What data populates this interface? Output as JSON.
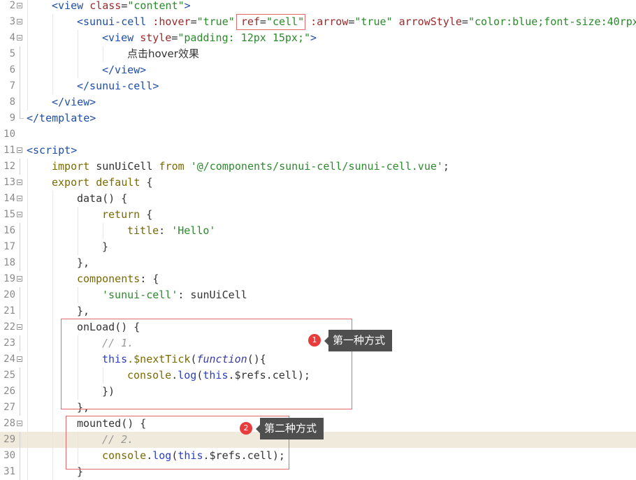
{
  "colors": {
    "tag": "#1f4ea8",
    "attr": "#9a2a2a",
    "string": "#2a8a2a",
    "keyword": "#7a6a00",
    "plain": "#333333",
    "comment": "#9a9a9a",
    "this": "#2a3fc0",
    "func_italic": "#3a3aa0",
    "highlight_bg": "#efeadb",
    "annotation_red": "#e26a6a",
    "badge_red": "#e83c3c",
    "callout_bg": "#4f4f4f"
  },
  "editor": {
    "lines": [
      {
        "num": "2",
        "fold": "open",
        "indent": 1,
        "tokens": [
          {
            "t": "<view ",
            "c": "tag"
          },
          {
            "t": "class",
            "c": "attr"
          },
          {
            "t": "=",
            "c": "plain"
          },
          {
            "t": "\"content\"",
            "c": "string"
          },
          {
            "t": ">",
            "c": "tag"
          }
        ]
      },
      {
        "num": "3",
        "fold": "open",
        "indent": 2,
        "tokens": [
          {
            "t": "<sunui-cell ",
            "c": "tag"
          },
          {
            "t": ":hover",
            "c": "attr"
          },
          {
            "t": "=",
            "c": "plain"
          },
          {
            "t": "\"true\"",
            "c": "string"
          },
          {
            "t": " ",
            "c": "plain"
          },
          {
            "t": "ref",
            "c": "attr"
          },
          {
            "t": "=",
            "c": "plain"
          },
          {
            "t": "\"cell\"",
            "c": "string"
          },
          {
            "t": " ",
            "c": "plain"
          },
          {
            "t": ":arrow",
            "c": "attr"
          },
          {
            "t": "=",
            "c": "plain"
          },
          {
            "t": "\"true\"",
            "c": "string"
          },
          {
            "t": " ",
            "c": "plain"
          },
          {
            "t": "arrowStyle",
            "c": "attr"
          },
          {
            "t": "=",
            "c": "plain"
          },
          {
            "t": "\"color:blue;font-size:40rpx",
            "c": "string"
          }
        ]
      },
      {
        "num": "4",
        "fold": "open",
        "indent": 3,
        "tokens": [
          {
            "t": "<view ",
            "c": "tag"
          },
          {
            "t": "style",
            "c": "attr"
          },
          {
            "t": "=",
            "c": "plain"
          },
          {
            "t": "\"padding: 12px 15px;\"",
            "c": "string"
          },
          {
            "t": ">",
            "c": "tag"
          }
        ]
      },
      {
        "num": "5",
        "fold": "line",
        "indent": 4,
        "tokens": [
          {
            "t": "点击hover效果",
            "c": "plain",
            "cjk": true
          }
        ]
      },
      {
        "num": "6",
        "fold": "line",
        "indent": 3,
        "tokens": [
          {
            "t": "</view>",
            "c": "tag"
          }
        ]
      },
      {
        "num": "7",
        "fold": "line",
        "indent": 2,
        "tokens": [
          {
            "t": "</sunui-cell>",
            "c": "tag"
          }
        ]
      },
      {
        "num": "8",
        "fold": "line",
        "indent": 1,
        "tokens": [
          {
            "t": "</view>",
            "c": "tag"
          }
        ]
      },
      {
        "num": "9",
        "fold": "end",
        "indent": 0,
        "tokens": [
          {
            "t": "</template>",
            "c": "tag"
          }
        ]
      },
      {
        "num": "10",
        "fold": "none",
        "indent": 0,
        "tokens": []
      },
      {
        "num": "11",
        "fold": "open",
        "indent": 0,
        "tokens": [
          {
            "t": "<script>",
            "c": "tag"
          }
        ]
      },
      {
        "num": "12",
        "fold": "line",
        "indent": 1,
        "tokens": [
          {
            "t": "import ",
            "c": "keyword"
          },
          {
            "t": "sunUiCell ",
            "c": "plain"
          },
          {
            "t": "from ",
            "c": "keyword"
          },
          {
            "t": "'@/components/sunui-cell/sunui-cell.vue'",
            "c": "string"
          },
          {
            "t": ";",
            "c": "plain"
          }
        ]
      },
      {
        "num": "13",
        "fold": "open",
        "indent": 1,
        "tokens": [
          {
            "t": "export default ",
            "c": "keyword"
          },
          {
            "t": "{",
            "c": "plain"
          }
        ]
      },
      {
        "num": "14",
        "fold": "open",
        "indent": 2,
        "tokens": [
          {
            "t": "data",
            "c": "plain"
          },
          {
            "t": "() {",
            "c": "plain"
          }
        ]
      },
      {
        "num": "15",
        "fold": "open",
        "indent": 3,
        "tokens": [
          {
            "t": "return ",
            "c": "keyword"
          },
          {
            "t": "{",
            "c": "plain"
          }
        ]
      },
      {
        "num": "16",
        "fold": "line",
        "indent": 4,
        "tokens": [
          {
            "t": "title",
            "c": "keyword"
          },
          {
            "t": ": ",
            "c": "plain"
          },
          {
            "t": "'Hello'",
            "c": "string"
          }
        ]
      },
      {
        "num": "17",
        "fold": "line",
        "indent": 3,
        "tokens": [
          {
            "t": "}",
            "c": "plain"
          }
        ]
      },
      {
        "num": "18",
        "fold": "line",
        "indent": 2,
        "tokens": [
          {
            "t": "},",
            "c": "plain"
          }
        ]
      },
      {
        "num": "19",
        "fold": "open",
        "indent": 2,
        "tokens": [
          {
            "t": "components",
            "c": "keyword"
          },
          {
            "t": ": {",
            "c": "plain"
          }
        ]
      },
      {
        "num": "20",
        "fold": "line",
        "indent": 3,
        "tokens": [
          {
            "t": "'sunui-cell'",
            "c": "string"
          },
          {
            "t": ": sunUiCell",
            "c": "plain"
          }
        ]
      },
      {
        "num": "21",
        "fold": "line",
        "indent": 2,
        "tokens": [
          {
            "t": "},",
            "c": "plain"
          }
        ]
      },
      {
        "num": "22",
        "fold": "open",
        "indent": 2,
        "tokens": [
          {
            "t": "onLoad",
            "c": "plain"
          },
          {
            "t": "() {",
            "c": "plain"
          }
        ]
      },
      {
        "num": "23",
        "fold": "line",
        "indent": 3,
        "tokens": [
          {
            "t": "// 1.",
            "c": "comment",
            "italic": true
          }
        ]
      },
      {
        "num": "24",
        "fold": "open",
        "indent": 3,
        "tokens": [
          {
            "t": "this",
            "c": "this"
          },
          {
            "t": ".$nextTick",
            "c": "keyword"
          },
          {
            "t": "(",
            "c": "plain"
          },
          {
            "t": "function",
            "c": "func_italic",
            "italic": true
          },
          {
            "t": "(){",
            "c": "plain"
          }
        ]
      },
      {
        "num": "25",
        "fold": "line",
        "indent": 4,
        "tokens": [
          {
            "t": "console",
            "c": "keyword"
          },
          {
            "t": ".",
            "c": "plain"
          },
          {
            "t": "log",
            "c": "this"
          },
          {
            "t": "(",
            "c": "plain"
          },
          {
            "t": "this",
            "c": "this"
          },
          {
            "t": ".$refs.cell);",
            "c": "plain"
          }
        ]
      },
      {
        "num": "26",
        "fold": "line",
        "indent": 3,
        "tokens": [
          {
            "t": "})",
            "c": "plain"
          }
        ]
      },
      {
        "num": "27",
        "fold": "line",
        "indent": 2,
        "tokens": [
          {
            "t": "},",
            "c": "plain"
          }
        ]
      },
      {
        "num": "28",
        "fold": "open",
        "indent": 2,
        "tokens": [
          {
            "t": "mounted",
            "c": "plain"
          },
          {
            "t": "() {",
            "c": "plain"
          }
        ]
      },
      {
        "num": "29",
        "fold": "line",
        "indent": 3,
        "highlight": true,
        "tokens": [
          {
            "t": "// 2.",
            "c": "comment",
            "italic": true
          }
        ]
      },
      {
        "num": "30",
        "fold": "line",
        "indent": 3,
        "tokens": [
          {
            "t": "console",
            "c": "keyword"
          },
          {
            "t": ".",
            "c": "plain"
          },
          {
            "t": "log",
            "c": "this"
          },
          {
            "t": "(",
            "c": "plain"
          },
          {
            "t": "this",
            "c": "this"
          },
          {
            "t": ".$refs.cell);",
            "c": "plain"
          }
        ]
      },
      {
        "num": "31",
        "fold": "line",
        "indent": 2,
        "tokens": [
          {
            "t": "}",
            "c": "plain"
          }
        ]
      }
    ]
  },
  "annotations": [
    {
      "badge": "1",
      "label": "第一种方式"
    },
    {
      "badge": "2",
      "label": "第二种方式"
    }
  ]
}
